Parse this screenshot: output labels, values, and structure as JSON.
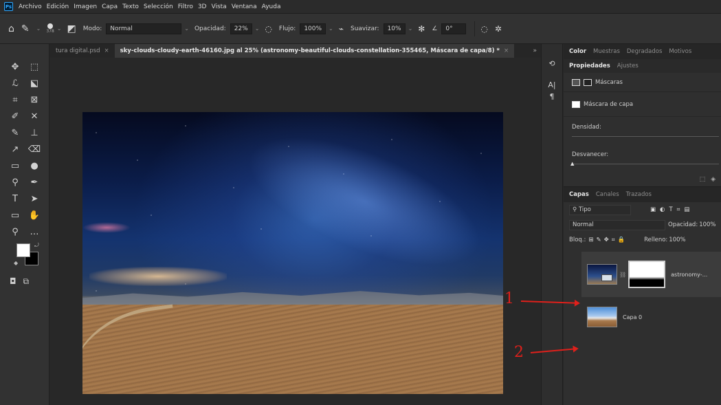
{
  "menu": {
    "logo": "Ps",
    "items": [
      "Archivo",
      "Edición",
      "Imagen",
      "Capa",
      "Texto",
      "Selección",
      "Filtro",
      "3D",
      "Vista",
      "Ventana",
      "Ayuda"
    ]
  },
  "options": {
    "brush_size": "378",
    "mode_label": "Modo:",
    "mode_value": "Normal",
    "opacity_label": "Opacidad:",
    "opacity_value": "22%",
    "flow_label": "Flujo:",
    "flow_value": "100%",
    "smooth_label": "Suavizar:",
    "smooth_value": "10%",
    "angle_value": "0°"
  },
  "tabs": [
    {
      "label": "tura digital.psd",
      "active": false
    },
    {
      "label": "sky-clouds-cloudy-earth-46160.jpg al 25% (astronomy-beautiful-clouds-constellation-355465, Máscara de capa/8) *",
      "active": true
    }
  ],
  "tabs_more": "»",
  "panel_top_tabs": [
    "Color",
    "Muestras",
    "Degradados",
    "Motivos"
  ],
  "properties": {
    "tabs": [
      "Propiedades",
      "Ajustes"
    ],
    "masks_label": "Máscaras",
    "layer_mask_label": "Máscara de capa",
    "density_label": "Densidad:",
    "feather_label": "Desvanecer:"
  },
  "layers_panel": {
    "tabs": [
      "Capas",
      "Canales",
      "Trazados"
    ],
    "filter_label": "Tipo",
    "blend_mode": "Normal",
    "opacity_label": "Opacidad:",
    "opacity_value": "100%",
    "lock_label": "Bloq.:",
    "fill_label": "Relleno:",
    "fill_value": "100%",
    "layers": [
      {
        "name": "astronomy-..."
      },
      {
        "name": "Capa 0"
      }
    ]
  },
  "annotations": [
    "1",
    "2"
  ],
  "colors": {
    "accent": "#31a8ff",
    "annotation": "#e0201b",
    "foreground": "#ffffff",
    "background": "#000000"
  }
}
